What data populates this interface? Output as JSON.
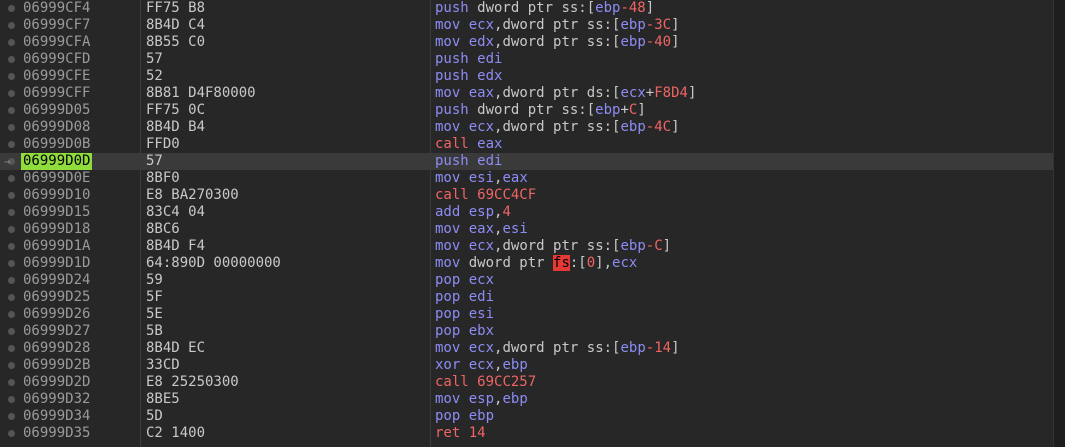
{
  "rows": [
    {
      "addr": "06999CF4",
      "bytes": "FF75 B8",
      "mn": "push",
      "ops": [
        {
          "t": "kw",
          "v": " dword ptr "
        },
        {
          "t": "seg",
          "v": "ss"
        },
        {
          "t": "plain",
          "v": ":["
        },
        {
          "t": "reg",
          "v": "ebp"
        },
        {
          "t": "num",
          "v": "-48"
        },
        {
          "t": "plain",
          "v": "]"
        }
      ]
    },
    {
      "addr": "06999CF7",
      "bytes": "8B4D C4",
      "mn": "mov",
      "ops": [
        {
          "t": "plain",
          "v": " "
        },
        {
          "t": "reg",
          "v": "ecx"
        },
        {
          "t": "plain",
          "v": ","
        },
        {
          "t": "kw",
          "v": "dword ptr "
        },
        {
          "t": "seg",
          "v": "ss"
        },
        {
          "t": "plain",
          "v": ":["
        },
        {
          "t": "reg",
          "v": "ebp"
        },
        {
          "t": "num",
          "v": "-3C"
        },
        {
          "t": "plain",
          "v": "]"
        }
      ]
    },
    {
      "addr": "06999CFA",
      "bytes": "8B55 C0",
      "mn": "mov",
      "ops": [
        {
          "t": "plain",
          "v": " "
        },
        {
          "t": "reg",
          "v": "edx"
        },
        {
          "t": "plain",
          "v": ","
        },
        {
          "t": "kw",
          "v": "dword ptr "
        },
        {
          "t": "seg",
          "v": "ss"
        },
        {
          "t": "plain",
          "v": ":["
        },
        {
          "t": "reg",
          "v": "ebp"
        },
        {
          "t": "num",
          "v": "-40"
        },
        {
          "t": "plain",
          "v": "]"
        }
      ]
    },
    {
      "addr": "06999CFD",
      "bytes": "57",
      "mn": "push",
      "ops": [
        {
          "t": "plain",
          "v": " "
        },
        {
          "t": "reg",
          "v": "edi"
        }
      ]
    },
    {
      "addr": "06999CFE",
      "bytes": "52",
      "mn": "push",
      "ops": [
        {
          "t": "plain",
          "v": " "
        },
        {
          "t": "reg",
          "v": "edx"
        }
      ]
    },
    {
      "addr": "06999CFF",
      "bytes": "8B81 D4F80000",
      "mn": "mov",
      "ops": [
        {
          "t": "plain",
          "v": " "
        },
        {
          "t": "reg",
          "v": "eax"
        },
        {
          "t": "plain",
          "v": ","
        },
        {
          "t": "kw",
          "v": "dword ptr "
        },
        {
          "t": "seg",
          "v": "ds"
        },
        {
          "t": "plain",
          "v": ":["
        },
        {
          "t": "reg",
          "v": "ecx"
        },
        {
          "t": "plain",
          "v": "+"
        },
        {
          "t": "num",
          "v": "F8D4"
        },
        {
          "t": "plain",
          "v": "]"
        }
      ]
    },
    {
      "addr": "06999D05",
      "bytes": "FF75 0C",
      "mn": "push",
      "ops": [
        {
          "t": "kw",
          "v": " dword ptr "
        },
        {
          "t": "seg",
          "v": "ss"
        },
        {
          "t": "plain",
          "v": ":["
        },
        {
          "t": "reg",
          "v": "ebp"
        },
        {
          "t": "plain",
          "v": "+"
        },
        {
          "t": "num",
          "v": "C"
        },
        {
          "t": "plain",
          "v": "]"
        }
      ]
    },
    {
      "addr": "06999D08",
      "bytes": "8B4D B4",
      "mn": "mov",
      "ops": [
        {
          "t": "plain",
          "v": " "
        },
        {
          "t": "reg",
          "v": "ecx"
        },
        {
          "t": "plain",
          "v": ","
        },
        {
          "t": "kw",
          "v": "dword ptr "
        },
        {
          "t": "seg",
          "v": "ss"
        },
        {
          "t": "plain",
          "v": ":["
        },
        {
          "t": "reg",
          "v": "ebp"
        },
        {
          "t": "num",
          "v": "-4C"
        },
        {
          "t": "plain",
          "v": "]"
        }
      ]
    },
    {
      "addr": "06999D0B",
      "bytes": "FFD0",
      "mn": "call",
      "call": true,
      "ops": [
        {
          "t": "plain",
          "v": " "
        },
        {
          "t": "reg",
          "v": "eax"
        }
      ]
    },
    {
      "addr": "06999D0D",
      "bytes": "57",
      "mn": "push",
      "current": true,
      "ops": [
        {
          "t": "plain",
          "v": " "
        },
        {
          "t": "reg",
          "v": "edi"
        }
      ]
    },
    {
      "addr": "06999D0E",
      "bytes": "8BF0",
      "mn": "mov",
      "ops": [
        {
          "t": "plain",
          "v": " "
        },
        {
          "t": "reg",
          "v": "esi"
        },
        {
          "t": "plain",
          "v": ","
        },
        {
          "t": "reg",
          "v": "eax"
        }
      ]
    },
    {
      "addr": "06999D10",
      "bytes": "E8 BA270300",
      "mn": "call",
      "call": true,
      "ops": [
        {
          "t": "plain",
          "v": " "
        },
        {
          "t": "num",
          "v": "69CC4CF"
        }
      ]
    },
    {
      "addr": "06999D15",
      "bytes": "83C4 04",
      "mn": "add",
      "ops": [
        {
          "t": "plain",
          "v": " "
        },
        {
          "t": "reg",
          "v": "esp"
        },
        {
          "t": "plain",
          "v": ","
        },
        {
          "t": "num",
          "v": "4"
        }
      ]
    },
    {
      "addr": "06999D18",
      "bytes": "8BC6",
      "mn": "mov",
      "ops": [
        {
          "t": "plain",
          "v": " "
        },
        {
          "t": "reg",
          "v": "eax"
        },
        {
          "t": "plain",
          "v": ","
        },
        {
          "t": "reg",
          "v": "esi"
        }
      ]
    },
    {
      "addr": "06999D1A",
      "bytes": "8B4D F4",
      "mn": "mov",
      "ops": [
        {
          "t": "plain",
          "v": " "
        },
        {
          "t": "reg",
          "v": "ecx"
        },
        {
          "t": "plain",
          "v": ","
        },
        {
          "t": "kw",
          "v": "dword ptr "
        },
        {
          "t": "seg",
          "v": "ss"
        },
        {
          "t": "plain",
          "v": ":["
        },
        {
          "t": "reg",
          "v": "ebp"
        },
        {
          "t": "num",
          "v": "-C"
        },
        {
          "t": "plain",
          "v": "]"
        }
      ]
    },
    {
      "addr": "06999D1D",
      "bytes": "64:890D 00000000",
      "mn": "mov",
      "ops": [
        {
          "t": "kw",
          "v": " dword ptr "
        },
        {
          "t": "seghl",
          "v": "fs"
        },
        {
          "t": "plain",
          "v": ":["
        },
        {
          "t": "num",
          "v": "0"
        },
        {
          "t": "plain",
          "v": "],"
        },
        {
          "t": "reg",
          "v": "ecx"
        }
      ]
    },
    {
      "addr": "06999D24",
      "bytes": "59",
      "mn": "pop",
      "ops": [
        {
          "t": "plain",
          "v": " "
        },
        {
          "t": "reg",
          "v": "ecx"
        }
      ]
    },
    {
      "addr": "06999D25",
      "bytes": "5F",
      "mn": "pop",
      "ops": [
        {
          "t": "plain",
          "v": " "
        },
        {
          "t": "reg",
          "v": "edi"
        }
      ]
    },
    {
      "addr": "06999D26",
      "bytes": "5E",
      "mn": "pop",
      "ops": [
        {
          "t": "plain",
          "v": " "
        },
        {
          "t": "reg",
          "v": "esi"
        }
      ]
    },
    {
      "addr": "06999D27",
      "bytes": "5B",
      "mn": "pop",
      "ops": [
        {
          "t": "plain",
          "v": " "
        },
        {
          "t": "reg",
          "v": "ebx"
        }
      ]
    },
    {
      "addr": "06999D28",
      "bytes": "8B4D EC",
      "mn": "mov",
      "ops": [
        {
          "t": "plain",
          "v": " "
        },
        {
          "t": "reg",
          "v": "ecx"
        },
        {
          "t": "plain",
          "v": ","
        },
        {
          "t": "kw",
          "v": "dword ptr "
        },
        {
          "t": "seg",
          "v": "ss"
        },
        {
          "t": "plain",
          "v": ":["
        },
        {
          "t": "reg",
          "v": "ebp"
        },
        {
          "t": "num",
          "v": "-14"
        },
        {
          "t": "plain",
          "v": "]"
        }
      ]
    },
    {
      "addr": "06999D2B",
      "bytes": "33CD",
      "mn": "xor",
      "ops": [
        {
          "t": "plain",
          "v": " "
        },
        {
          "t": "reg",
          "v": "ecx"
        },
        {
          "t": "plain",
          "v": ","
        },
        {
          "t": "reg",
          "v": "ebp"
        }
      ]
    },
    {
      "addr": "06999D2D",
      "bytes": "E8 25250300",
      "mn": "call",
      "call": true,
      "ops": [
        {
          "t": "plain",
          "v": " "
        },
        {
          "t": "num",
          "v": "69CC257"
        }
      ]
    },
    {
      "addr": "06999D32",
      "bytes": "8BE5",
      "mn": "mov",
      "ops": [
        {
          "t": "plain",
          "v": " "
        },
        {
          "t": "reg",
          "v": "esp"
        },
        {
          "t": "plain",
          "v": ","
        },
        {
          "t": "reg",
          "v": "ebp"
        }
      ]
    },
    {
      "addr": "06999D34",
      "bytes": "5D",
      "mn": "pop",
      "ops": [
        {
          "t": "plain",
          "v": " "
        },
        {
          "t": "reg",
          "v": "ebp"
        }
      ]
    },
    {
      "addr": "06999D35",
      "bytes": "C2 1400",
      "mn": "ret",
      "call": true,
      "ops": [
        {
          "t": "plain",
          "v": " "
        },
        {
          "t": "num",
          "v": "14"
        }
      ]
    }
  ],
  "colors": {
    "background": "#272727",
    "current_row": "#3a3a3a",
    "current_addr_highlight": "#8fdc3c",
    "mnemonic": "#8c8cf4",
    "call_mnemonic": "#f06464",
    "number": "#f06464",
    "segment_highlight": "#e53935"
  }
}
